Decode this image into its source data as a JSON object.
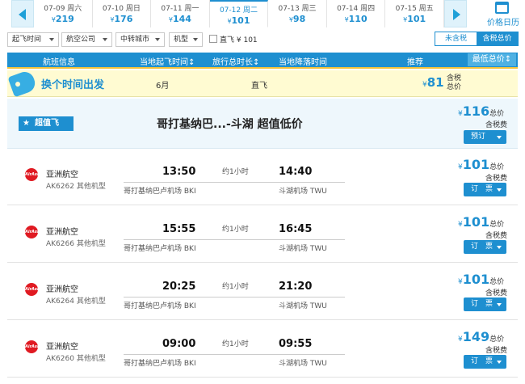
{
  "dates": [
    {
      "date": "07-09 周六",
      "price": "219"
    },
    {
      "date": "07-10 周日",
      "price": "176"
    },
    {
      "date": "07-11 周一",
      "price": "144"
    },
    {
      "date": "07-12 周二",
      "price": "101",
      "active": true
    },
    {
      "date": "07-13 周三",
      "price": "98"
    },
    {
      "date": "07-14 周四",
      "price": "110"
    },
    {
      "date": "07-15 周五",
      "price": "101"
    }
  ],
  "currency": "¥",
  "calendar_label": "价格日历",
  "filters": {
    "depart_time": "起飞时间",
    "airline": "航空公司",
    "transfer_city": "中转城市",
    "aircraft": "机型",
    "direct_label": "直飞",
    "direct_price": "¥ 101",
    "tax_excluded": "未含税",
    "tax_included": "含税总价"
  },
  "columns": {
    "info": "航班信息",
    "depart": "当地起飞时间↕",
    "duration": "旅行总时长↕",
    "arrive": "当地降落时间",
    "recommend": "推荐",
    "lowest": "最低总价↕"
  },
  "change_time": {
    "title": "换个时间出发",
    "month": "6月",
    "type": "直飞",
    "price": "81",
    "tax_note": "含税总价"
  },
  "super_value": {
    "badge": "超值飞",
    "headline": "哥打基纳巴...-斗湖 超值低价",
    "price": "116",
    "total_label": "总价",
    "tax_label": "含税费",
    "button": "预订"
  },
  "flights": [
    {
      "airline": "亚洲航空",
      "number": "AK6262 其他机型",
      "dep": "13:50",
      "arr": "14:40",
      "duration": "约1小时",
      "dep_airport": "哥打基纳巴卢机场 BKI",
      "arr_airport": "斗湖机场 TWU",
      "price": "101",
      "total_label": "总价",
      "tax_label": "含税费",
      "button": "订　票"
    },
    {
      "airline": "亚洲航空",
      "number": "AK6266 其他机型",
      "dep": "15:55",
      "arr": "16:45",
      "duration": "约1小时",
      "dep_airport": "哥打基纳巴卢机场 BKI",
      "arr_airport": "斗湖机场 TWU",
      "price": "101",
      "total_label": "总价",
      "tax_label": "含税费",
      "button": "订　票"
    },
    {
      "airline": "亚洲航空",
      "number": "AK6264 其他机型",
      "dep": "20:25",
      "arr": "21:20",
      "duration": "约1小时",
      "dep_airport": "哥打基纳巴卢机场 BKI",
      "arr_airport": "斗湖机场 TWU",
      "price": "101",
      "total_label": "总价",
      "tax_label": "含税费",
      "button": "订　票"
    },
    {
      "airline": "亚洲航空",
      "number": "AK6260 其他机型",
      "dep": "09:00",
      "arr": "09:55",
      "duration": "约1小时",
      "dep_airport": "哥打基纳巴卢机场 BKI",
      "arr_airport": "斗湖机场 TWU",
      "price": "149",
      "total_label": "总价",
      "tax_label": "含税费",
      "button": "订　票"
    }
  ],
  "logo_text": "AirAsia",
  "colors": {
    "accent": "#1e8fd0",
    "highlight": "#fffbd2",
    "airline_red": "#e01a22"
  }
}
